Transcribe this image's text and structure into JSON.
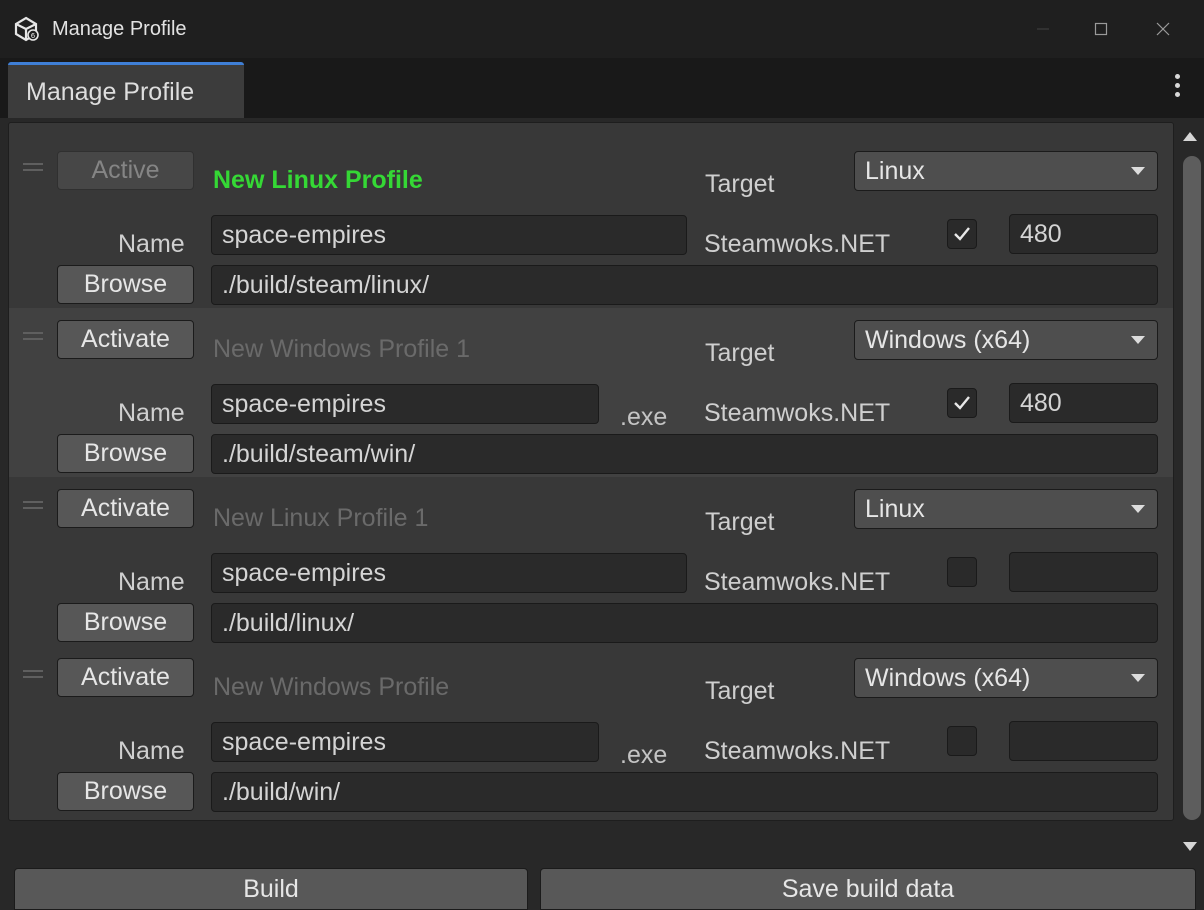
{
  "window": {
    "title": "Manage Profile",
    "icons": {
      "app": "unity-logo-icon",
      "minimize": "minimize-icon",
      "maximize": "maximize-icon",
      "close": "close-icon"
    }
  },
  "tabs": [
    {
      "label": "Manage Profile",
      "active": true
    }
  ],
  "labels": {
    "name": "Name",
    "target": "Target",
    "steam": "Steamwoks.NET",
    "browse": "Browse",
    "exe": ".exe"
  },
  "profiles": [
    {
      "button": "Active",
      "button_enabled": false,
      "profile_name": "New Linux Profile",
      "is_active": true,
      "target": "Linux",
      "name": "space-empires",
      "show_exe": false,
      "steam_checked": true,
      "app_id": "480",
      "path": "./build/steam/linux/"
    },
    {
      "button": "Activate",
      "button_enabled": true,
      "profile_name": "New Windows Profile 1",
      "is_active": false,
      "target": "Windows (x64)",
      "name": "space-empires",
      "show_exe": true,
      "steam_checked": true,
      "app_id": "480",
      "path": "./build/steam/win/"
    },
    {
      "button": "Activate",
      "button_enabled": true,
      "profile_name": "New Linux Profile 1",
      "is_active": false,
      "target": "Linux",
      "name": "space-empires",
      "show_exe": false,
      "steam_checked": false,
      "app_id": "",
      "path": "./build/linux/"
    },
    {
      "button": "Activate",
      "button_enabled": true,
      "profile_name": "New Windows Profile",
      "is_active": false,
      "target": "Windows (x64)",
      "name": "space-empires",
      "show_exe": true,
      "steam_checked": false,
      "app_id": "",
      "path": "./build/win/"
    }
  ],
  "footer": {
    "build_label": "Build",
    "save_label": "Save build data"
  },
  "colors": {
    "accent": "#3f7fd6",
    "active_profile": "#35d835",
    "background": "#282828"
  }
}
